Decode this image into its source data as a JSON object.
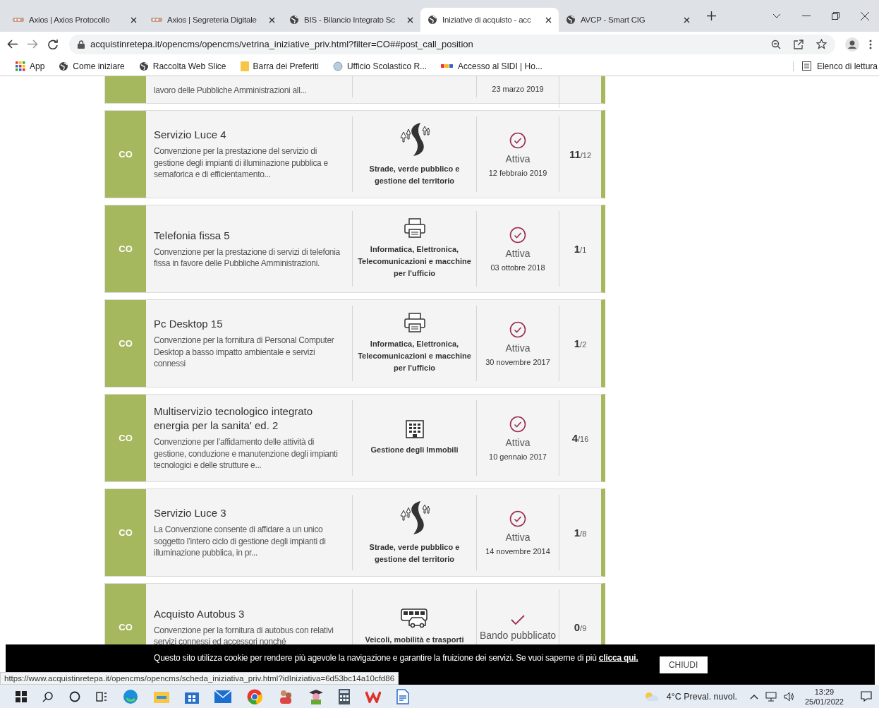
{
  "browser": {
    "tabs": [
      {
        "title": "Axios | Axios Protocollo",
        "selected": false
      },
      {
        "title": "Axios | Segreteria Digitale",
        "selected": false
      },
      {
        "title": "BIS - Bilancio Integrato Sc",
        "selected": false
      },
      {
        "title": "Iniziative di acquisto - acc",
        "selected": true
      },
      {
        "title": "AVCP - Smart CIG",
        "selected": false
      }
    ],
    "address": "acquistinretepa.it/opencms/opencms/vetrina_iniziative_priv.html?filter=CO##post_call_position",
    "bookmarks": [
      {
        "label": "App"
      },
      {
        "label": "Come iniziare"
      },
      {
        "label": "Raccolta Web Slice"
      },
      {
        "label": "Barra dei Preferiti"
      },
      {
        "label": "Ufficio Scolastico R..."
      },
      {
        "label": "Accesso al SIDI | Ho..."
      }
    ],
    "reading_list": "Elenco di lettura"
  },
  "partial_card": {
    "description": "lavoro delle Pubbliche Amministrazioni all...",
    "date": "23 marzo 2019"
  },
  "cards": [
    {
      "badge": "CO",
      "title": "Servizio Luce 4",
      "description": "Convenzione per la prestazione del servizio di gestione degli impianti di illuminazione pubblica e semaforica e di efficientamento...",
      "category": {
        "kind": "road",
        "label": "Strade, verde pubblico e gestione del territorio"
      },
      "status": {
        "kind": "active",
        "label": "Attiva"
      },
      "date": "12 febbraio 2019",
      "count": "11",
      "total": "/12"
    },
    {
      "badge": "CO",
      "title": "Telefonia fissa 5",
      "description": "Convenzione per la prestazione di servizi di telefonia fissa in favore delle Pubbliche Amministrazioni.",
      "category": {
        "kind": "printer",
        "label": "Informatica, Elettronica, Telecomunicazioni e macchine per l'ufficio"
      },
      "status": {
        "kind": "active",
        "label": "Attiva"
      },
      "date": "03 ottobre 2018",
      "count": "1",
      "total": "/1"
    },
    {
      "badge": "CO",
      "title": "Pc Desktop 15",
      "description": "Convenzione per la fornitura di Personal Computer Desktop a basso impatto ambientale e servizi connessi",
      "category": {
        "kind": "printer",
        "label": "Informatica, Elettronica, Telecomunicazioni e macchine per l'ufficio"
      },
      "status": {
        "kind": "active",
        "label": "Attiva"
      },
      "date": "30 novembre 2017",
      "count": "1",
      "total": "/2"
    },
    {
      "badge": "CO",
      "title": "Multiservizio tecnologico integrato energia per la sanita' ed. 2",
      "description": "Convenzione per l’affidamento delle attività di gestione, conduzione e manutenzione degli impianti tecnologici e delle strutture e...",
      "category": {
        "kind": "building",
        "label": "Gestione degli Immobili"
      },
      "status": {
        "kind": "active",
        "label": "Attiva"
      },
      "date": "10 gennaio 2017",
      "count": "4",
      "total": "/16"
    },
    {
      "badge": "CO",
      "title": "Servizio Luce 3",
      "description": "La Convenzione consente di affidare a un unico soggetto l’intero ciclo di gestione degli impianti di illuminazione pubblica, in pr...",
      "category": {
        "kind": "road",
        "label": "Strade, verde pubblico e gestione del territorio"
      },
      "status": {
        "kind": "active",
        "label": "Attiva"
      },
      "date": "14 novembre 2014",
      "count": "1",
      "total": "/8"
    },
    {
      "badge": "CO",
      "title": "Acquisto Autobus 3",
      "description": "Convenzione per la fornitura di autobus con relativi servizi connessi ed accessori nonché",
      "category": {
        "kind": "vehicles",
        "label": "Veicoli, mobilità e trasporti"
      },
      "status": {
        "kind": "published",
        "label": "Bando pubblicato"
      },
      "count": "0",
      "total": "/9"
    }
  ],
  "cookie_banner": {
    "text": "Questo sito utilizza cookie per rendere più agevole la navigazione e garantire la fruizione dei servizi. Se vuoi saperne di più",
    "link": "clicca qui.",
    "button": "CHIUDI"
  },
  "status_url": "https://www.acquistinretepa.it/opencms/opencms/scheda_iniziativa_priv.html?idIniziativa=6d53bc14a10cfd86",
  "taskbar": {
    "weather": "4°C Preval. nuvol.",
    "time": "13:29",
    "date": "25/01/2022"
  }
}
